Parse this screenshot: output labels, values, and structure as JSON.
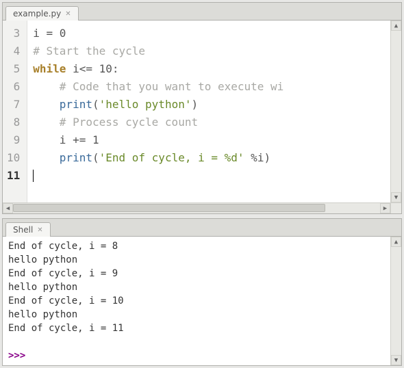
{
  "editor": {
    "tab_label": "example.py",
    "gutter": [
      "3",
      "4",
      "5",
      "6",
      "7",
      "8",
      "9",
      "10",
      "11"
    ],
    "current_gutter_index": 8,
    "lines": [
      {
        "indent": "",
        "tokens": [
          {
            "t": "i ",
            "c": "op"
          },
          {
            "t": "= ",
            "c": "op"
          },
          {
            "t": "0",
            "c": "num"
          }
        ]
      },
      {
        "indent": "",
        "tokens": [
          {
            "t": "# Start the cycle",
            "c": "cm"
          }
        ]
      },
      {
        "indent": "",
        "tokens": [
          {
            "t": "while",
            "c": "kw"
          },
          {
            "t": " i",
            "c": "op"
          },
          {
            "t": "<= ",
            "c": "op"
          },
          {
            "t": "10",
            "c": "num"
          },
          {
            "t": ":",
            "c": "op"
          }
        ]
      },
      {
        "indent": "    ",
        "tokens": [
          {
            "t": "# Code that you want to execute wi",
            "c": "cm"
          }
        ]
      },
      {
        "indent": "    ",
        "tokens": [
          {
            "t": "print",
            "c": "fn"
          },
          {
            "t": "(",
            "c": "op"
          },
          {
            "t": "'hello python'",
            "c": "str"
          },
          {
            "t": ")",
            "c": "op"
          }
        ]
      },
      {
        "indent": "    ",
        "tokens": [
          {
            "t": "# Process cycle count",
            "c": "cm"
          }
        ]
      },
      {
        "indent": "    ",
        "tokens": [
          {
            "t": "i ",
            "c": "op"
          },
          {
            "t": "+= ",
            "c": "op"
          },
          {
            "t": "1",
            "c": "num"
          }
        ]
      },
      {
        "indent": "    ",
        "tokens": [
          {
            "t": "print",
            "c": "fn"
          },
          {
            "t": "(",
            "c": "op"
          },
          {
            "t": "'End of cycle, i = %d'",
            "c": "str"
          },
          {
            "t": " ",
            "c": "op"
          },
          {
            "t": "%",
            "c": "op"
          },
          {
            "t": "i)",
            "c": "op"
          }
        ]
      },
      {
        "indent": "",
        "tokens": []
      }
    ]
  },
  "shell": {
    "tab_label": "Shell",
    "lines": [
      "End of cycle, i = 8",
      "hello python",
      "End of cycle, i = 9",
      "hello python",
      "End of cycle, i = 10",
      "hello python",
      "End of cycle, i = 11"
    ],
    "prompt": ">>> "
  }
}
